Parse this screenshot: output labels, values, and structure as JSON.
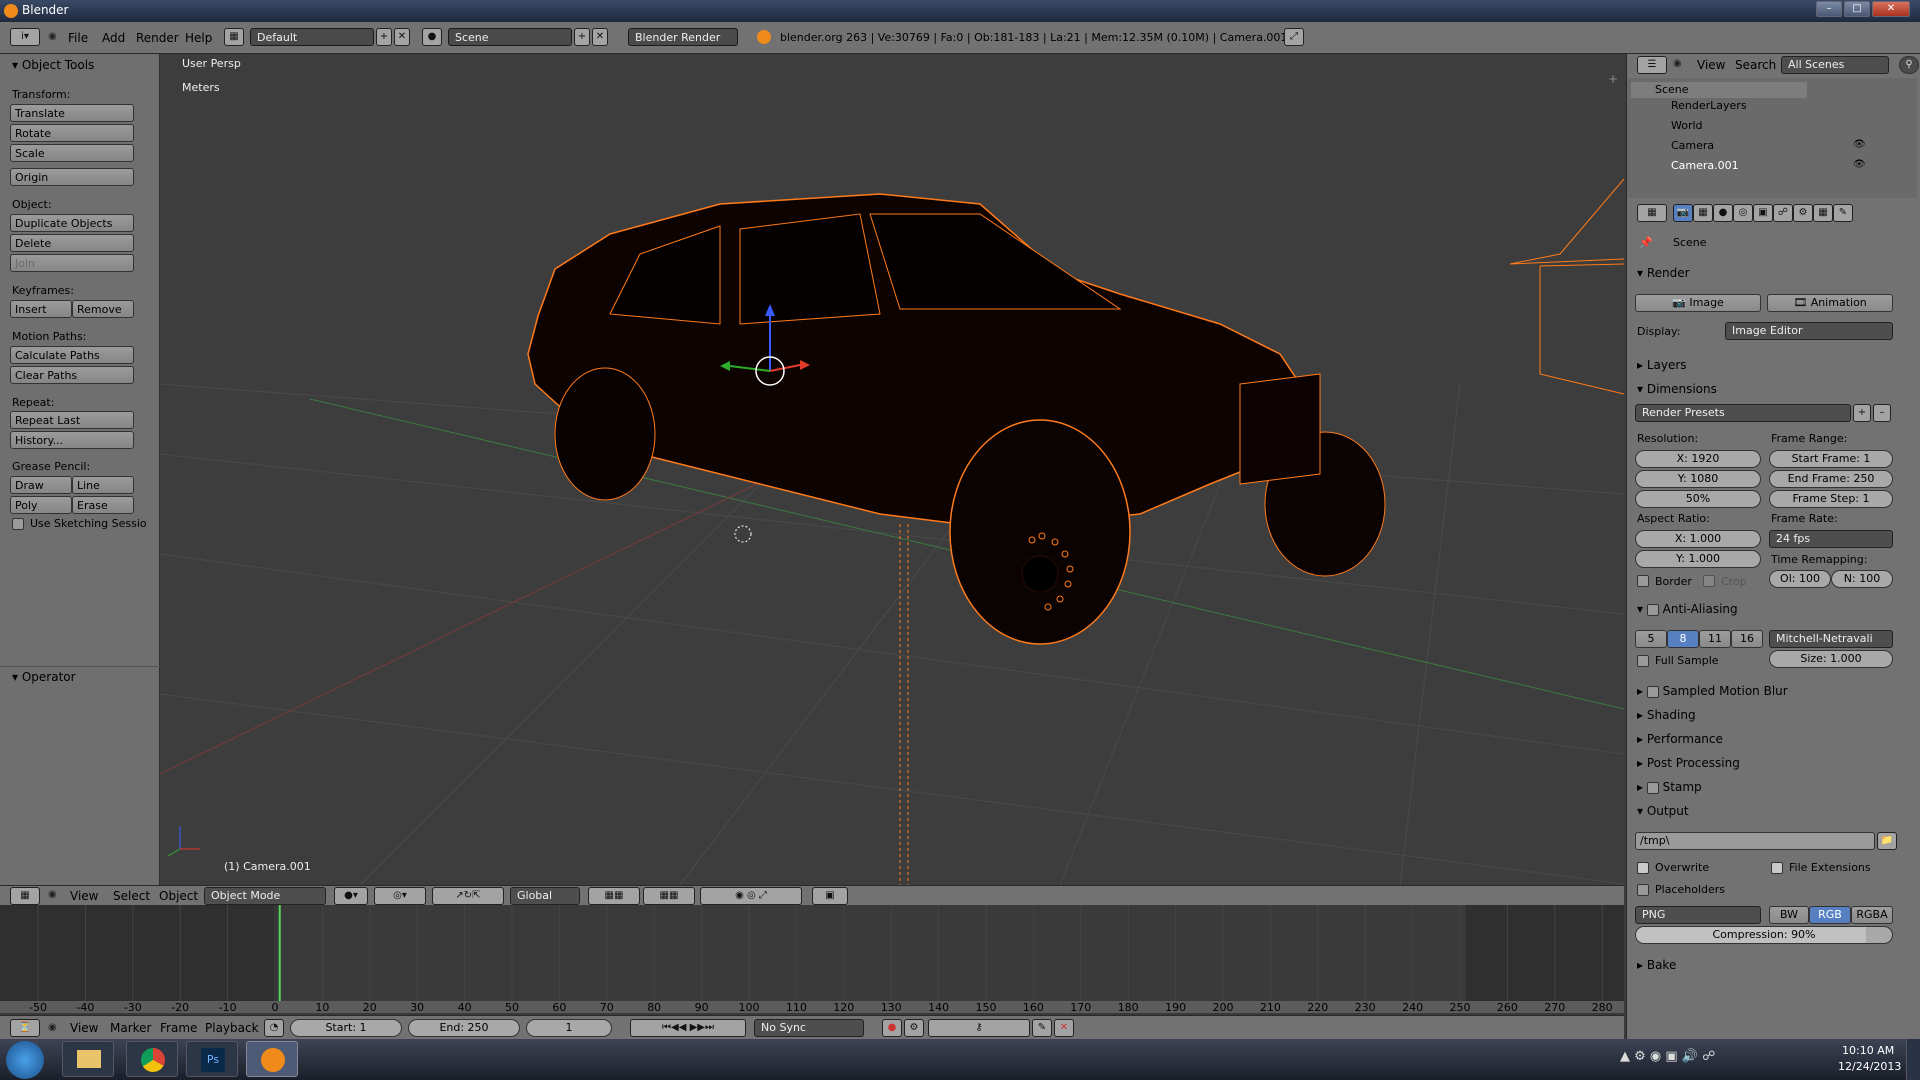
{
  "window": {
    "title": "Blender"
  },
  "menu": {
    "file": "File",
    "add": "Add",
    "render": "Render",
    "help": "Help"
  },
  "layout": {
    "value": "Default"
  },
  "scene": {
    "value": "Scene"
  },
  "engine": {
    "value": "Blender Render"
  },
  "stats": "blender.org 263 | Ve:30769 | Fa:0 | Ob:181-183 | La:21 | Mem:12.35M (0.10M) | Camera.001",
  "toolshelf": {
    "header": "Object Tools",
    "transform": "Transform:",
    "translate": "Translate",
    "rotate": "Rotate",
    "scale": "Scale",
    "origin": "Origin",
    "object": "Object:",
    "duplicate": "Duplicate Objects",
    "delete": "Delete",
    "join": "Join",
    "keyframes": "Keyframes:",
    "insert": "Insert",
    "remove": "Remove",
    "motion_paths": "Motion Paths:",
    "calc_paths": "Calculate Paths",
    "clear_paths": "Clear Paths",
    "repeat": "Repeat:",
    "repeat_last": "Repeat Last",
    "history": "History...",
    "grease": "Grease Pencil:",
    "draw": "Draw",
    "line": "Line",
    "poly": "Poly",
    "erase": "Erase",
    "sketch": "Use Sketching Sessio",
    "operator": "Operator"
  },
  "viewport": {
    "persp": "User Persp",
    "units": "Meters",
    "object_label": "(1) Camera.001"
  },
  "view_header": {
    "view": "View",
    "select": "Select",
    "object": "Object",
    "mode": "Object Mode",
    "orient": "Global"
  },
  "timeline": {
    "ticks": [
      "-50",
      "-40",
      "-30",
      "-20",
      "-10",
      "0",
      "10",
      "20",
      "30",
      "40",
      "50",
      "60",
      "70",
      "80",
      "90",
      "100",
      "110",
      "120",
      "130",
      "140",
      "150",
      "160",
      "170",
      "180",
      "190",
      "200",
      "210",
      "220",
      "230",
      "240",
      "250",
      "260",
      "270",
      "280"
    ],
    "current_frame": 1,
    "view": "View",
    "marker": "Marker",
    "frame": "Frame",
    "playback": "Playback",
    "start": "Start: 1",
    "end": "End: 250",
    "frame_value": "1",
    "sync": "No Sync"
  },
  "outliner": {
    "view": "View",
    "search": "Search",
    "filter": "All Scenes",
    "items": [
      "Scene",
      "RenderLayers",
      "World",
      "Camera",
      "Camera.001"
    ]
  },
  "properties": {
    "context": "Scene",
    "render": "Render",
    "image_btn": "Image",
    "animation_btn": "Animation",
    "display_label": "Display:",
    "display_value": "Image Editor",
    "layers": "Layers",
    "dimensions": "Dimensions",
    "presets": "Render Presets",
    "resolution": "Resolution:",
    "res_x": "X: 1920",
    "res_y": "Y: 1080",
    "res_pct": "50%",
    "frame_range": "Frame Range:",
    "start_frame": "Start Frame: 1",
    "end_frame": "End Frame: 250",
    "frame_step": "Frame Step: 1",
    "aspect": "Aspect Ratio:",
    "asp_x": "X: 1.000",
    "asp_y": "Y: 1.000",
    "frame_rate": "Frame Rate:",
    "fps": "24 fps",
    "time_remap": "Time Remapping:",
    "remap_old": "Ol: 100",
    "remap_new": "N: 100",
    "border": "Border",
    "crop": "Crop",
    "aa": "Anti-Aliasing",
    "aa_5": "5",
    "aa_8": "8",
    "aa_11": "11",
    "aa_16": "16",
    "aa_filter": "Mitchell-Netravali",
    "full_sample": "Full Sample",
    "aa_size": "Size: 1.000",
    "motion_blur": "Sampled Motion Blur",
    "shading": "Shading",
    "performance": "Performance",
    "post": "Post Processing",
    "stamp": "Stamp",
    "output": "Output",
    "path": "/tmp\\",
    "overwrite": "Overwrite",
    "file_ext": "File Extensions",
    "placeholders": "Placeholders",
    "format": "PNG",
    "bw": "BW",
    "rgb": "RGB",
    "rgba": "RGBA",
    "compression": "Compression: 90%",
    "compression_value": 0.9,
    "bake": "Bake"
  },
  "taskbar": {
    "time": "10:10 AM",
    "date": "12/24/2013"
  },
  "colors": {
    "accent": "#5680c2",
    "wire": "#ff7a1a"
  }
}
